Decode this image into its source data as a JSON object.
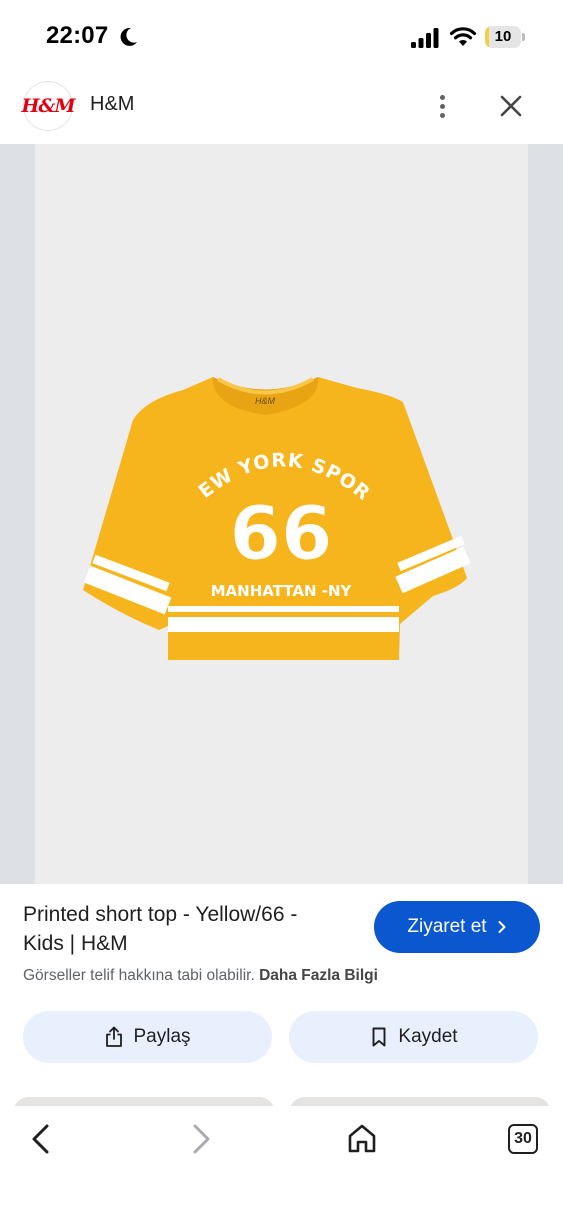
{
  "status_bar": {
    "time": "22:07",
    "battery_level": "10",
    "battery_fraction": 0.1,
    "icons": [
      "moon-icon",
      "signal-icon",
      "wifi-icon",
      "battery-icon"
    ]
  },
  "header": {
    "logo_text": "H&M",
    "site_name": "H&M",
    "icons": [
      "more-vert-icon",
      "close-icon"
    ]
  },
  "product_image": {
    "shirt_print_top": "NEW YORK SPORT",
    "shirt_print_number": "66",
    "shirt_print_bottom": "MANHATTAN -NY",
    "shirt_label": "H&M",
    "shirt_color": "#f7b51d"
  },
  "info": {
    "title": "Printed short top - Yellow/66 - Kids | H&M",
    "visit_label": "Ziyaret et",
    "copyright_text": "Görseller telif hakkına tabi olabilir.",
    "learn_more": "Daha Fazla Bilgi"
  },
  "actions": {
    "share_label": "Paylaş",
    "save_label": "Kaydet"
  },
  "bottom_nav": {
    "tab_count": "30",
    "icons": [
      "back-icon",
      "forward-icon",
      "home-icon",
      "tabs-icon"
    ]
  },
  "colors": {
    "accent": "#0b57d0",
    "action_bg": "#e8f0fe",
    "brand_red": "#e50010",
    "image_bg": "#ededee"
  }
}
